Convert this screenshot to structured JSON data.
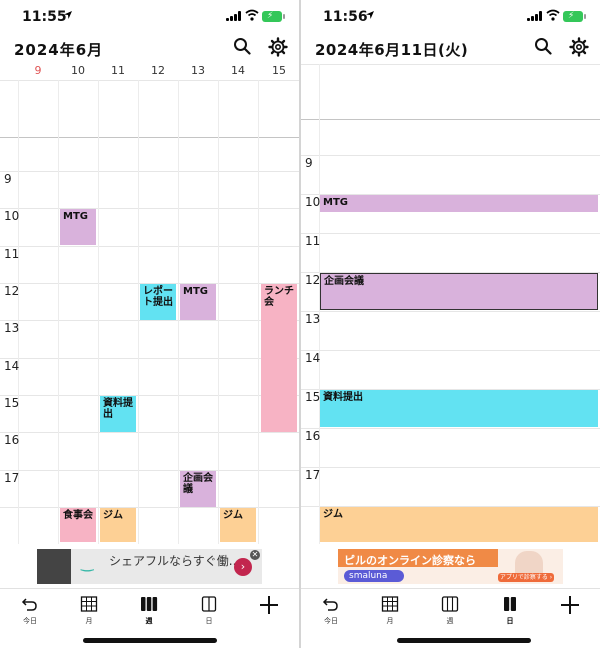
{
  "left": {
    "status_time": "11:55",
    "title": "2024年6月",
    "days": [
      "9",
      "10",
      "11",
      "12",
      "13",
      "14",
      "15"
    ],
    "hours": [
      "9",
      "10",
      "11",
      "12",
      "13",
      "14",
      "15",
      "16",
      "17"
    ],
    "events": {
      "mtg_mon": "MTG",
      "report_wed": "レポート提出",
      "mtg_thu": "MTG",
      "lunch_sat": "ランチ会",
      "docs_tue": "資料提出",
      "plan_thu": "企画会議",
      "dinner_mon": "食事会",
      "gym_tue": "ジム",
      "gym_fri": "ジム"
    },
    "ad": {
      "text": "シェアフルならすぐ働...",
      "smile": "‿",
      "close": "✕",
      "go": "›"
    }
  },
  "right": {
    "status_time": "11:56",
    "title": "2024年6月11日(火)",
    "hours": [
      "9",
      "10",
      "11",
      "12",
      "13",
      "14",
      "15",
      "16",
      "17"
    ],
    "events": {
      "mtg": "MTG",
      "plan": "企画会議",
      "docs": "資料提出",
      "gym": "ジム"
    },
    "ad": {
      "text": "ピルのオンライン診察なら",
      "logo": "smaluna",
      "button": "アプリで診察する ›"
    }
  },
  "tabbar": {
    "today": "今日",
    "month": "月",
    "week": "週",
    "day": "日"
  },
  "colors": {
    "purple": "#d9b2dc",
    "cyan": "#62e2f2",
    "pink": "#f7b3c4",
    "orange": "#fdd095",
    "sunday": "#e05555"
  },
  "icons": [
    "location-arrow-icon",
    "signal-icon",
    "wifi-icon",
    "battery-charging-icon",
    "search-icon",
    "gear-icon",
    "undo-icon",
    "month-grid-icon",
    "week-columns-icon",
    "day-column-icon",
    "add-icon"
  ]
}
